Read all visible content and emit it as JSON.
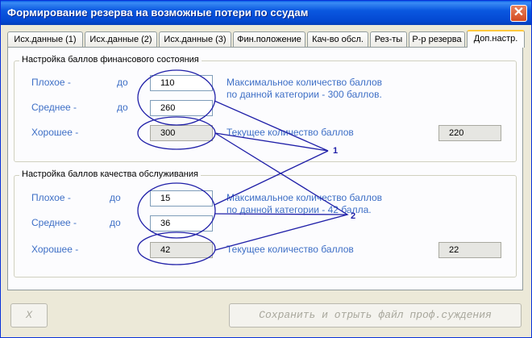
{
  "window": {
    "title": "Формирование резерва на возможные потери по ссудам",
    "close_glyph": "✕"
  },
  "tabs": [
    {
      "label": "Исх.данные (1)"
    },
    {
      "label": "Исх.данные (2)"
    },
    {
      "label": "Исх.данные (3)"
    },
    {
      "label": "Фин.положение"
    },
    {
      "label": "Кач-во обсл."
    },
    {
      "label": "Рез-ты"
    },
    {
      "label": "Р-р резерва"
    },
    {
      "label": "Доп.настр."
    }
  ],
  "active_tab": "Доп.настр.",
  "financial": {
    "title": "Настройка баллов финансового состояния",
    "bad_label": "Плохое -",
    "bad_to": "до",
    "bad_value": "110",
    "mid_label": "Среднее -",
    "mid_to": "до",
    "mid_value": "260",
    "good_label": "Хорошее -",
    "good_value": "300",
    "max_line1": "Максимальное количество баллов",
    "max_line2": "по данной категории - 300 баллов.",
    "current_label": "Текущее количество баллов",
    "current_value": "220"
  },
  "service": {
    "title": "Настройка баллов качества обслуживания",
    "bad_label": "Плохое -",
    "bad_to": "до",
    "bad_value": "15",
    "mid_label": "Среднее -",
    "mid_to": "до",
    "mid_value": "36",
    "good_label": "Хорошее -",
    "good_value": "42",
    "max_line1": "Максимальное количество баллов",
    "max_line2": "по данной категории - 42 балла.",
    "current_label": "Текущее количество баллов",
    "current_value": "22"
  },
  "annotations": {
    "marker1": "1",
    "marker2": "2"
  },
  "buttons": {
    "close": "X",
    "save": "Сохранить и отрыть файл проф.суждения"
  },
  "colors": {
    "annotation": "#1f1fa8",
    "label": "#3e6fc6",
    "titlebar": "#0a58e0"
  }
}
